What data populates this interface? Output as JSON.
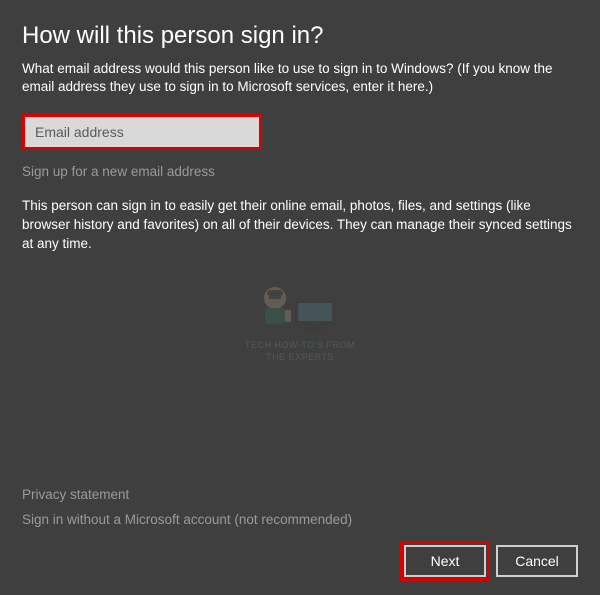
{
  "title": "How will this person sign in?",
  "subtitle": "What email address would this person like to use to sign in to Windows? (If you know the email address they use to sign in to Microsoft services, enter it here.)",
  "email": {
    "placeholder": "Email address",
    "value": ""
  },
  "links": {
    "signup": "Sign up for a new email address",
    "privacy": "Privacy statement",
    "no_ms_account": "Sign in without a Microsoft account (not recommended)"
  },
  "body_text": "This person can sign in to easily get their online email, photos, files, and settings (like browser history and favorites) on all of their devices. They can manage their synced settings at any time.",
  "buttons": {
    "next": "Next",
    "cancel": "Cancel"
  },
  "watermark": {
    "line1": "TECH HOW-TO'S FROM",
    "line2": "THE EXPERTS"
  }
}
